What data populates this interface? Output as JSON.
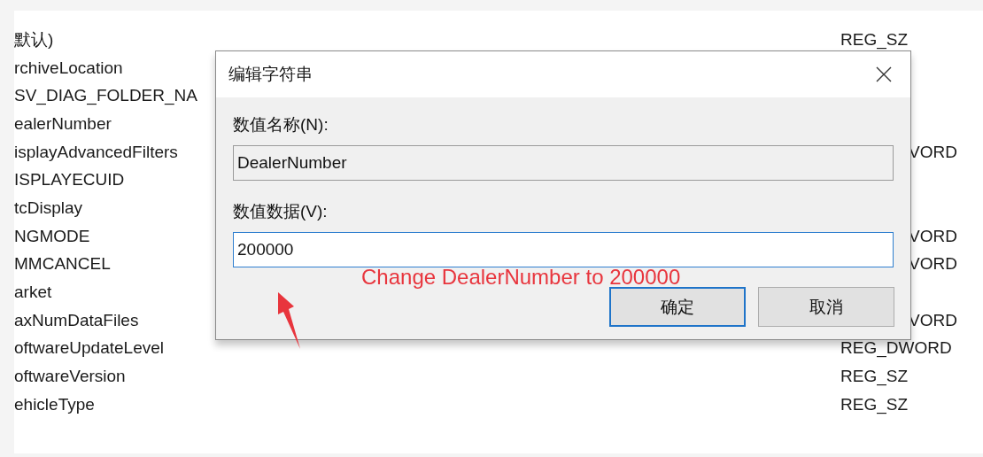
{
  "list": {
    "rows": [
      {
        "name": "默认)",
        "type": "REG_SZ",
        "type_clipped": false
      },
      {
        "name": "rchiveLocation"
      },
      {
        "name": "SV_DIAG_FOLDER_NA"
      },
      {
        "name": "ealerNumber"
      },
      {
        "name": "isplayAdvancedFilters",
        "type": "VORD",
        "type_clipped": true
      },
      {
        "name": "ISPLAYECUID"
      },
      {
        "name": "tcDisplay"
      },
      {
        "name": "NGMODE",
        "type": "VORD",
        "type_clipped": true
      },
      {
        "name": "MMCANCEL",
        "type": "VORD",
        "type_clipped": true
      },
      {
        "name": "arket"
      },
      {
        "name": "axNumDataFiles",
        "type": "VORD",
        "type_clipped": true
      },
      {
        "name": "oftwareUpdateLevel",
        "type": "REG_DWORD",
        "type_clipped": false
      },
      {
        "name": "oftwareVersion",
        "type": "REG_SZ",
        "type_clipped": false
      },
      {
        "name": "ehicleType",
        "type": "REG_SZ",
        "type_clipped": false
      }
    ]
  },
  "dialog": {
    "title": "编辑字符串",
    "name_label": "数值名称(N):",
    "name_value": "DealerNumber",
    "data_label": "数值数据(V):",
    "data_value": "200000",
    "buttons": [
      {
        "label": "确定",
        "default": true
      },
      {
        "label": "取消",
        "default": false
      }
    ]
  },
  "annotation": {
    "text": "Change DealerNumber to 200000"
  }
}
